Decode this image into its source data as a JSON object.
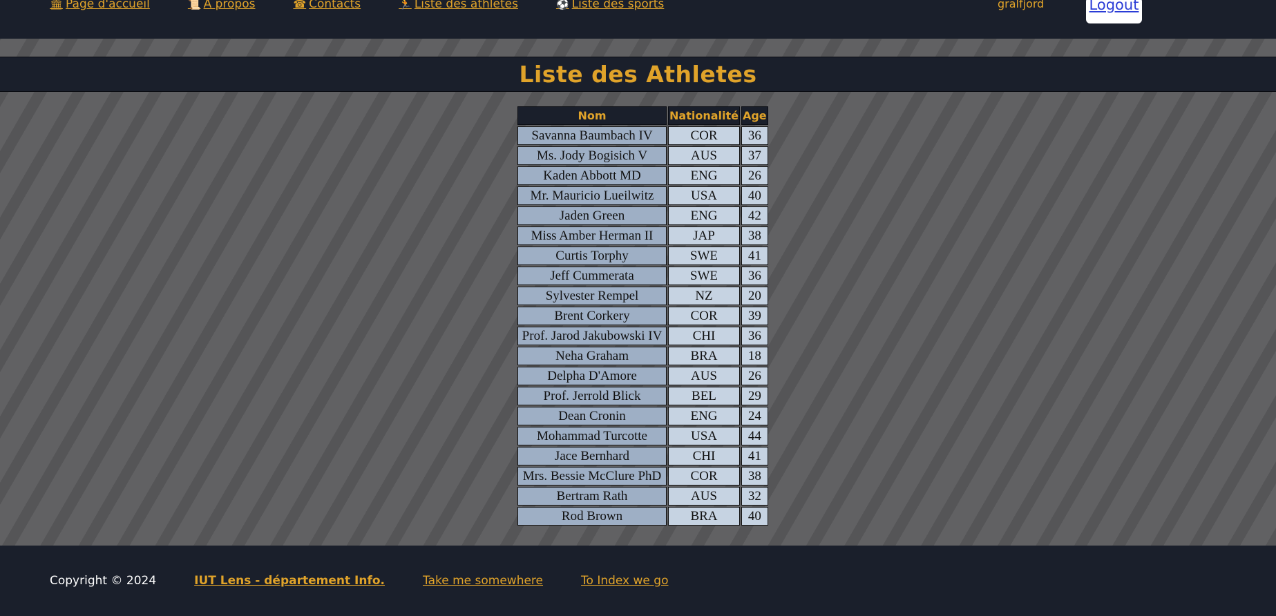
{
  "header": {
    "nav": [
      {
        "icon": "🏛",
        "icon_name": "home-icon",
        "label": "Page d'accueil"
      },
      {
        "icon": "📜",
        "icon_name": "scroll-icon",
        "label": "A propos"
      },
      {
        "icon": "☎",
        "icon_name": "phone-icon",
        "label": "Contacts"
      },
      {
        "icon": "🏃",
        "icon_name": "athlete-icon",
        "label": "Liste des athletes"
      },
      {
        "icon": "⚽",
        "icon_name": "sports-icon",
        "label": "Liste des sports"
      }
    ],
    "username": "gralfjord",
    "logout_label": "Logout"
  },
  "title": "Liste des Athletes",
  "table": {
    "columns": [
      "Nom",
      "Nationalité",
      "Age"
    ],
    "rows": [
      [
        "Savanna Baumbach IV",
        "COR",
        "36"
      ],
      [
        "Ms. Jody Bogisich V",
        "AUS",
        "37"
      ],
      [
        "Kaden Abbott MD",
        "ENG",
        "26"
      ],
      [
        "Mr. Mauricio Lueilwitz",
        "USA",
        "40"
      ],
      [
        "Jaden Green",
        "ENG",
        "42"
      ],
      [
        "Miss Amber Herman II",
        "JAP",
        "38"
      ],
      [
        "Curtis Torphy",
        "SWE",
        "41"
      ],
      [
        "Jeff Cummerata",
        "SWE",
        "36"
      ],
      [
        "Sylvester Rempel",
        "NZ",
        "20"
      ],
      [
        "Brent Corkery",
        "COR",
        "39"
      ],
      [
        "Prof. Jarod Jakubowski IV",
        "CHI",
        "36"
      ],
      [
        "Neha Graham",
        "BRA",
        "18"
      ],
      [
        "Delpha D'Amore",
        "AUS",
        "26"
      ],
      [
        "Prof. Jerrold Blick",
        "BEL",
        "29"
      ],
      [
        "Dean Cronin",
        "ENG",
        "24"
      ],
      [
        "Mohammad Turcotte",
        "USA",
        "44"
      ],
      [
        "Jace Bernhard",
        "CHI",
        "41"
      ],
      [
        "Mrs. Bessie McClure PhD",
        "COR",
        "38"
      ],
      [
        "Bertram Rath",
        "AUS",
        "32"
      ],
      [
        "Rod Brown",
        "BRA",
        "40"
      ]
    ]
  },
  "footer": {
    "copyright": "Copyright © 2024",
    "links": [
      {
        "label": "IUT Lens - département Info."
      },
      {
        "label": "Take me somewhere"
      },
      {
        "label": "To Index we go"
      }
    ]
  },
  "colors": {
    "dark_bar": "#1a1f2b",
    "accent": "#e0a32a",
    "name_cell": "#9eafc5",
    "value_cell": "#c6d3e2",
    "logout_link": "#2a3cd6"
  }
}
